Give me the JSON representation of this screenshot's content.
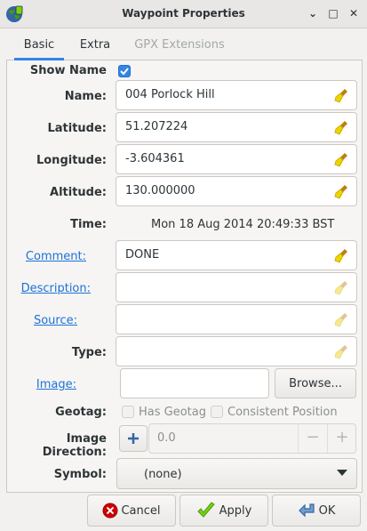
{
  "window": {
    "title": "Waypoint Properties",
    "controls": [
      "minimize",
      "maximize",
      "close"
    ],
    "minimize_glyph": "⌄",
    "maximize_glyph": "□",
    "close_glyph": "✕"
  },
  "tabs": [
    {
      "label": "Basic",
      "active": true
    },
    {
      "label": "Extra",
      "active": false
    },
    {
      "label": "GPX Extensions",
      "active": false,
      "disabled": true
    }
  ],
  "fields": {
    "show_name": {
      "label": "Show Name",
      "checked": true
    },
    "name": {
      "label": "Name:",
      "value": "004 Porlock Hill"
    },
    "latitude": {
      "label": "Latitude:",
      "value": "51.207224"
    },
    "longitude": {
      "label": "Longitude:",
      "value": "-3.604361"
    },
    "altitude": {
      "label": "Altitude:",
      "value": "130.000000"
    },
    "time": {
      "label": "Time:",
      "value": "Mon 18 Aug 2014 20:49:33 BST"
    },
    "comment": {
      "label": "Comment:",
      "value": "DONE"
    },
    "description": {
      "label": "Description:",
      "value": ""
    },
    "source": {
      "label": "Source:",
      "value": ""
    },
    "type": {
      "label": "Type:",
      "value": ""
    },
    "image": {
      "label": "Image:",
      "value": "",
      "browse_label": "Browse..."
    },
    "geotag": {
      "label": "Geotag:",
      "has_geotag": "Has Geotag",
      "consistent_position": "Consistent Position"
    },
    "image_direction": {
      "label": "Image Direction:",
      "value": "0.0",
      "minus": "−",
      "plus": "+"
    },
    "symbol": {
      "label": "Symbol:",
      "value": "(none)"
    }
  },
  "buttons": {
    "cancel": "Cancel",
    "apply": "Apply",
    "ok": "OK"
  },
  "colors": {
    "accent": "#3584e4",
    "link": "#1c71d8",
    "cancel_icon": "#cc0000",
    "apply_icon": "#73d216",
    "ok_icon": "#3465a4"
  },
  "icons": [
    "globe-icon",
    "broom-clear-icon",
    "checkmark-icon",
    "plus-icon",
    "chevron-down-icon",
    "cancel-icon",
    "apply-check-icon",
    "ok-arrow-icon"
  ]
}
